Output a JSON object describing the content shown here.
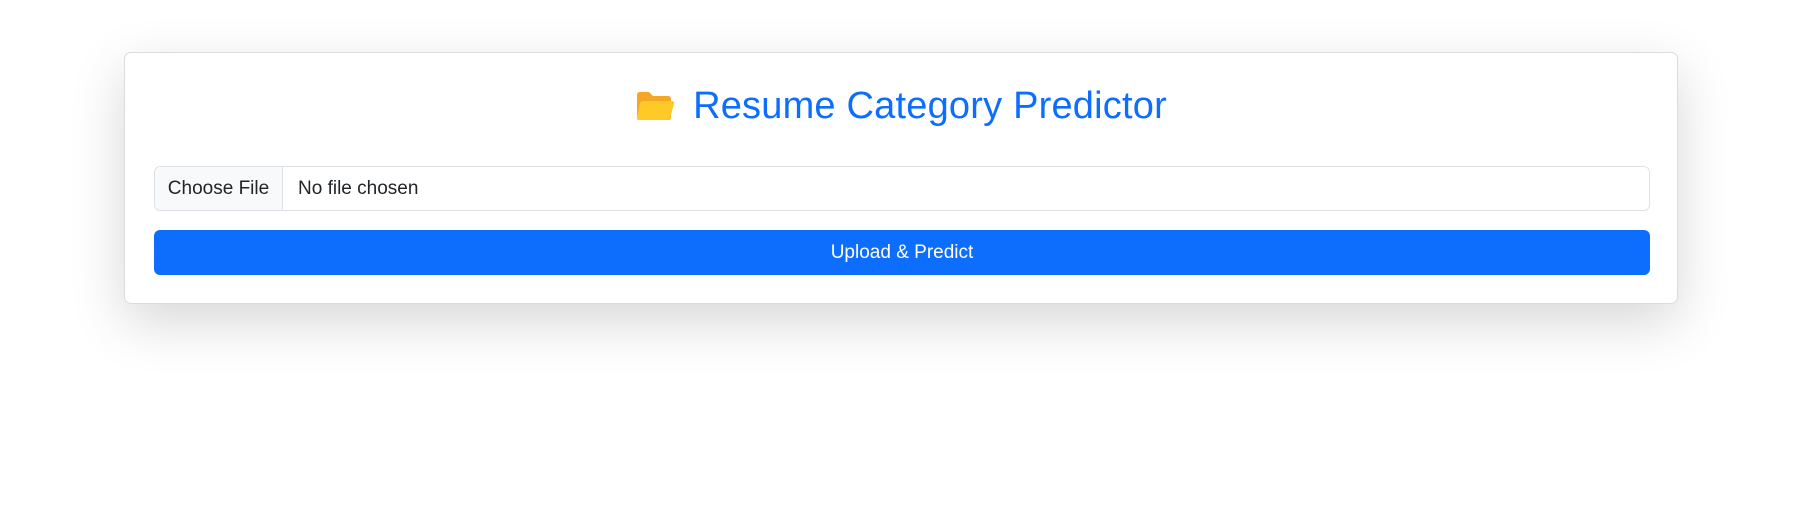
{
  "header": {
    "icon": "open-folder-icon",
    "title": "Resume Category Predictor"
  },
  "upload_form": {
    "choose_file_label": "Choose File",
    "file_status": "No file chosen",
    "submit_label": "Upload & Predict"
  },
  "colors": {
    "accent": "#0d6efd",
    "folder": "#ffca28",
    "folder_back": "#f5a623"
  }
}
